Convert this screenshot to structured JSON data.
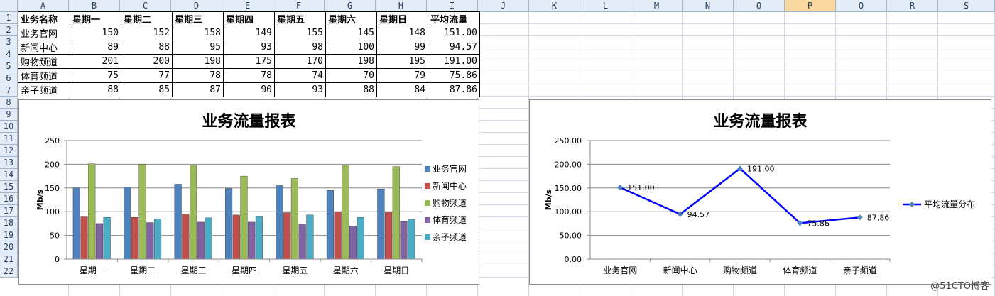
{
  "sheet": {
    "columns": [
      "A",
      "B",
      "C",
      "D",
      "E",
      "F",
      "G",
      "H",
      "I",
      "J",
      "K",
      "L",
      "M",
      "N",
      "O",
      "P",
      "Q",
      "R",
      "S"
    ],
    "selected_column": "P",
    "rows": [
      "1",
      "2",
      "3",
      "4",
      "5",
      "6",
      "7",
      "8",
      "9",
      "10",
      "11",
      "12",
      "13",
      "14",
      "15",
      "16",
      "17",
      "18",
      "19",
      "20",
      "21",
      "22"
    ]
  },
  "table": {
    "header": [
      "业务名称",
      "星期一",
      "星期二",
      "星期三",
      "星期四",
      "星期五",
      "星期六",
      "星期日",
      "平均流量"
    ],
    "rows": [
      [
        "业务官网",
        "150",
        "152",
        "158",
        "149",
        "155",
        "145",
        "148",
        "151.00"
      ],
      [
        "新闻中心",
        "89",
        "88",
        "95",
        "93",
        "98",
        "100",
        "99",
        "94.57"
      ],
      [
        "购物频道",
        "201",
        "200",
        "198",
        "175",
        "170",
        "198",
        "195",
        "191.00"
      ],
      [
        "体育频道",
        "75",
        "77",
        "78",
        "78",
        "74",
        "70",
        "79",
        "75.86"
      ],
      [
        "亲子频道",
        "88",
        "85",
        "87",
        "90",
        "93",
        "88",
        "84",
        "87.86"
      ]
    ]
  },
  "chart_data": [
    {
      "type": "bar",
      "title": "业务流量报表",
      "ylabel": "Mb/s",
      "xlabel": "",
      "categories": [
        "星期一",
        "星期二",
        "星期三",
        "星期四",
        "星期五",
        "星期六",
        "星期日"
      ],
      "ylim": [
        0,
        250
      ],
      "yticks": [
        "0",
        "50",
        "100",
        "150",
        "200",
        "250"
      ],
      "legend_position": "right",
      "series": [
        {
          "name": "业务官网",
          "color": "#4f81bd",
          "values": [
            150,
            152,
            158,
            149,
            155,
            145,
            148
          ]
        },
        {
          "name": "新闻中心",
          "color": "#c0504d",
          "values": [
            89,
            88,
            95,
            93,
            98,
            100,
            99
          ]
        },
        {
          "name": "购物频道",
          "color": "#9bbb59",
          "values": [
            201,
            200,
            198,
            175,
            170,
            198,
            195
          ]
        },
        {
          "name": "体育频道",
          "color": "#8064a2",
          "values": [
            75,
            77,
            78,
            78,
            74,
            70,
            79
          ]
        },
        {
          "name": "亲子频道",
          "color": "#4bacc6",
          "values": [
            88,
            85,
            87,
            90,
            93,
            88,
            84
          ]
        }
      ]
    },
    {
      "type": "line",
      "title": "业务流量报表",
      "ylabel": "Mb/s",
      "xlabel": "",
      "categories": [
        "业务官网",
        "新闻中心",
        "购物频道",
        "体育频道",
        "亲子频道"
      ],
      "ylim": [
        0,
        250
      ],
      "yticks": [
        "0.00",
        "50.00",
        "100.00",
        "150.00",
        "200.00",
        "250.00"
      ],
      "legend_position": "right",
      "series": [
        {
          "name": "平均流量分布",
          "color": "#0000ff",
          "marker_color": "#4f81bd",
          "values": [
            151.0,
            94.57,
            191.0,
            75.86,
            87.86
          ],
          "labels": [
            "151.00",
            "94.57",
            "191.00",
            "75.86",
            "87.86"
          ]
        }
      ]
    }
  ],
  "watermark": "@51CTO博客"
}
